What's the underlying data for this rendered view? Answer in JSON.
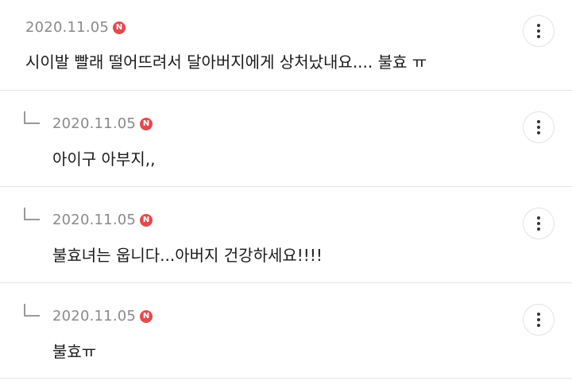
{
  "comments": [
    {
      "date": "2020.11.05",
      "badge": "N",
      "text": "시이발 빨래 떨어뜨려서 달아버지에게 상처났내요.... 불효 ㅠ",
      "is_reply": false
    },
    {
      "date": "2020.11.05",
      "badge": "N",
      "text": "아이구 아부지,,",
      "is_reply": true
    },
    {
      "date": "2020.11.05",
      "badge": "N",
      "text": "불효녀는 웁니다...아버지 건강하세요!!!!",
      "is_reply": true
    },
    {
      "date": "2020.11.05",
      "badge": "N",
      "text": "불효ㅠ",
      "is_reply": true
    }
  ],
  "icons": {
    "reply": "reply-arrow-icon",
    "more": "more-vertical-icon",
    "new": "new-badge-icon"
  },
  "colors": {
    "badge": "#e5484d",
    "date": "#8a8a8a",
    "divider": "#e6e6e6"
  }
}
